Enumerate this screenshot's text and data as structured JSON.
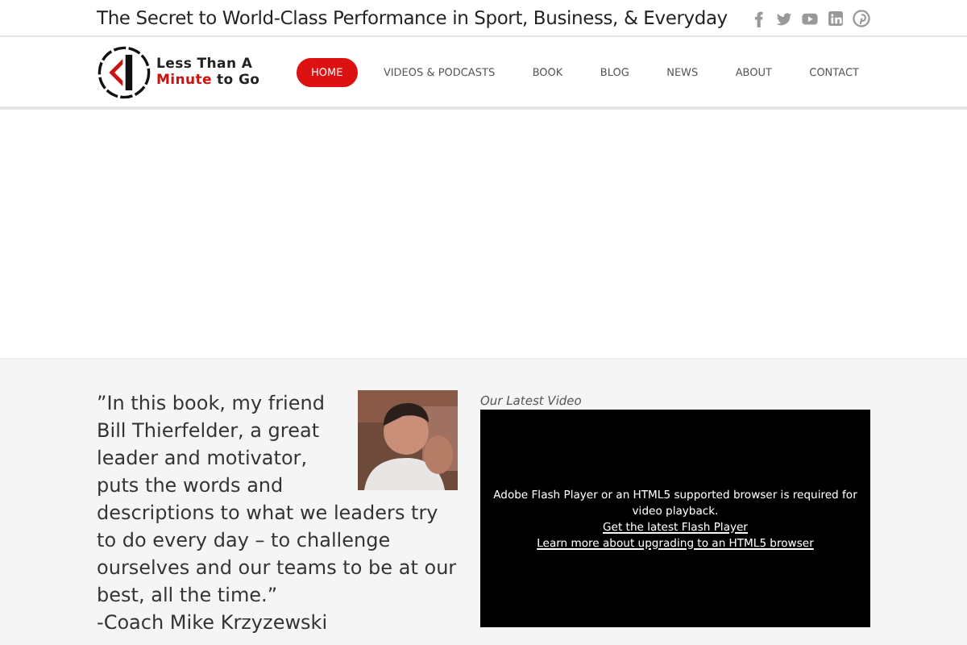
{
  "top_bar": {
    "tagline": "The Secret to World-Class Performance in Sport, Business, & Everyday",
    "social_icons": [
      {
        "kind": "facebook"
      },
      {
        "kind": "twitter"
      },
      {
        "kind": "youtube"
      },
      {
        "kind": "linkedin"
      },
      {
        "kind": "pinterest"
      }
    ]
  },
  "header": {
    "logo": {
      "line_1": "Less Than A",
      "line_2_accent": "Minute",
      "line_2_rest": "to Go"
    },
    "nav": [
      {
        "label": "HOME",
        "selected": true
      },
      {
        "label": "VIDEOS & PODCASTS",
        "selected": false
      },
      {
        "label": "BOOK",
        "selected": false
      },
      {
        "label": "BLOG",
        "selected": false
      },
      {
        "label": "NEWS",
        "selected": false
      },
      {
        "label": "ABOUT",
        "selected": false
      },
      {
        "label": "CONTACT",
        "selected": false
      }
    ]
  },
  "testimonial": {
    "quote": [
      "”In this book, my friend Bill Thierfelder, a great leader and motivator, puts the words and",
      "descriptions to what we leaders try to do every day – to challenge ourselves and our teams to be at our best, all the time.”"
    ],
    "attribution": "-Coach Mike Krzyzewski"
  },
  "video": {
    "heading": "Our Latest Video",
    "message": "Adobe Flash Player or an HTML5 supported browser is required for video playback.",
    "links": [
      "Get the latest Flash Player",
      "Learn more about upgrading to an HTML5 browser"
    ]
  }
}
